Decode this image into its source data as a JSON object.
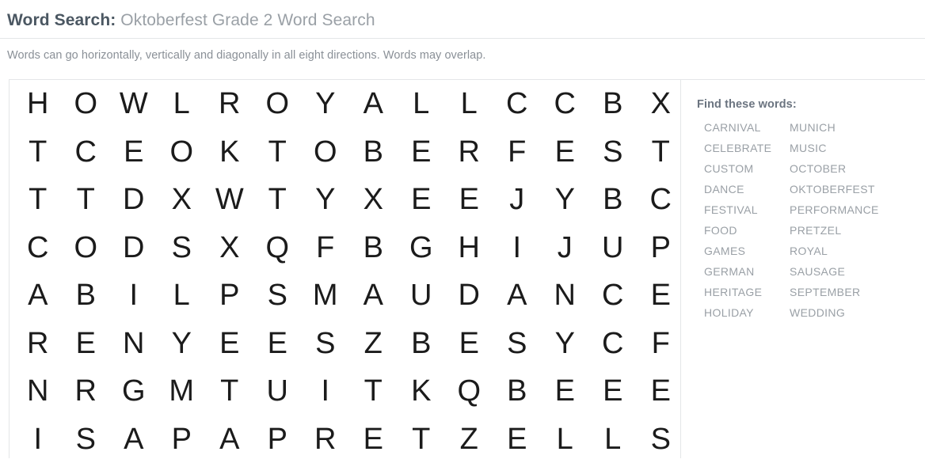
{
  "header": {
    "label": "Word Search:",
    "title": "Oktoberfest Grade 2 Word Search",
    "instructions": "Words can go horizontally, vertically and diagonally in all eight directions. Words may overlap."
  },
  "puzzle": {
    "rows": 8,
    "columns": 14,
    "grid": [
      [
        "H",
        "O",
        "W",
        "L",
        "R",
        "O",
        "Y",
        "A",
        "L",
        "L",
        "C",
        "C",
        "B",
        "X"
      ],
      [
        "T",
        "C",
        "E",
        "O",
        "K",
        "T",
        "O",
        "B",
        "E",
        "R",
        "F",
        "E",
        "S",
        "T"
      ],
      [
        "T",
        "T",
        "D",
        "X",
        "W",
        "T",
        "Y",
        "X",
        "E",
        "E",
        "J",
        "Y",
        "B",
        "C"
      ],
      [
        "C",
        "O",
        "D",
        "S",
        "X",
        "Q",
        "F",
        "B",
        "G",
        "H",
        "I",
        "J",
        "U",
        "P"
      ],
      [
        "A",
        "B",
        "I",
        "L",
        "P",
        "S",
        "M",
        "A",
        "U",
        "D",
        "A",
        "N",
        "C",
        "E"
      ],
      [
        "R",
        "E",
        "N",
        "Y",
        "E",
        "E",
        "S",
        "Z",
        "B",
        "E",
        "S",
        "Y",
        "C",
        "F"
      ],
      [
        "N",
        "R",
        "G",
        "M",
        "T",
        "U",
        "I",
        "T",
        "K",
        "Q",
        "B",
        "E",
        "E",
        "E"
      ],
      [
        "I",
        "S",
        "A",
        "P",
        "A",
        "P",
        "R",
        "E",
        "T",
        "Z",
        "E",
        "L",
        "L",
        "S"
      ]
    ]
  },
  "word_list": {
    "heading": "Find these words:",
    "rows": [
      [
        "CARNIVAL",
        "MUNICH"
      ],
      [
        "CELEBRATE",
        "MUSIC"
      ],
      [
        "CUSTOM",
        "OCTOBER"
      ],
      [
        "DANCE",
        "OKTOBERFEST"
      ],
      [
        "FESTIVAL",
        "PERFORMANCE"
      ],
      [
        "FOOD",
        "PRETZEL"
      ],
      [
        "GAMES",
        "ROYAL"
      ],
      [
        "GERMAN",
        "SAUSAGE"
      ],
      [
        "HERITAGE",
        "SEPTEMBER"
      ],
      [
        "HOLIDAY",
        "WEDDING"
      ]
    ]
  },
  "colors": {
    "label_text": "#4b5762",
    "title_text": "#9aa0a6",
    "instruction_text": "#8a9097",
    "grid_letter": "#1b1b1b",
    "word_text": "#9aa0a6",
    "heading_text": "#6b7480",
    "border": "#e4e6e8",
    "background": "#ffffff"
  }
}
